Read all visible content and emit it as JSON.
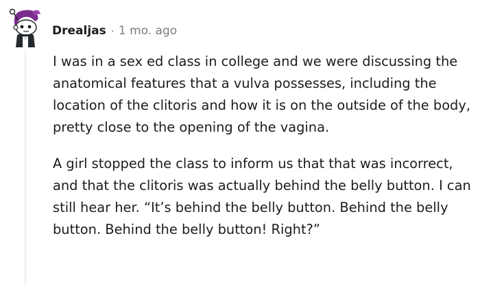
{
  "comment": {
    "author": "Drealjas",
    "separator": "·",
    "timestamp": "1 mo. ago",
    "avatar_icon": "snoo-avatar-icon",
    "paragraphs": [
      "I was in a sex ed class in college and we were discussing the anatomical features that a vulva possesses, including the location of the clitoris and how it is on the outside of the body, pretty close to the opening of the vagina.",
      "A girl stopped the class to inform us that that was incorrect, and that the clitoris was actually behind the belly button. I can still hear her. “It’s behind the belly button. Behind the belly button. Behind the belly button! Right?”"
    ]
  },
  "colors": {
    "text": "#1c1c1c",
    "meta": "#7c7c7c",
    "thread_line": "#edeff1",
    "avatar_hair": "#7b2d8e"
  }
}
